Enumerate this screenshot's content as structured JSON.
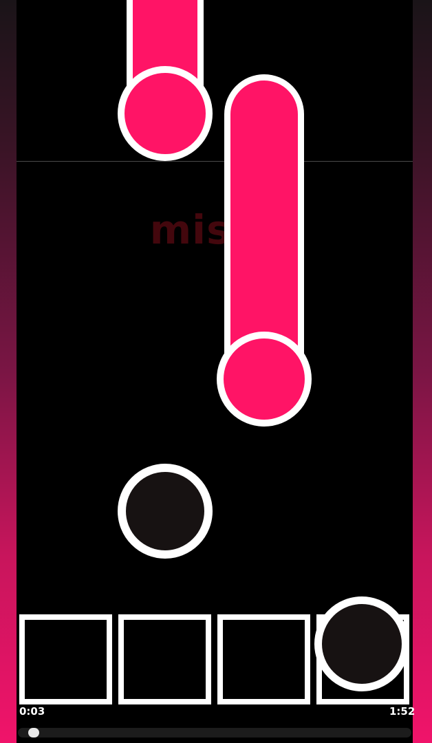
{
  "game": {
    "judgement": {
      "word": "miss",
      "trail": "..."
    },
    "time": {
      "elapsed": "0:03",
      "total": "1:52"
    },
    "progress": 0.027,
    "lanes": 4,
    "colors": {
      "note_pink": "#ff1466",
      "note_outline": "#ffffff",
      "tap_fill": "#171212",
      "playfield_bg": "#000000"
    }
  }
}
